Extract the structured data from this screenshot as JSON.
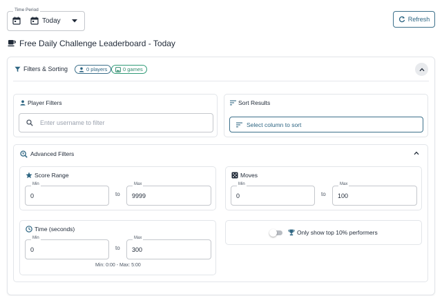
{
  "time_period": {
    "legend": "Time Period",
    "value": "Today"
  },
  "header": {
    "refresh_label": "Refresh",
    "page_title": "Free Daily Challenge Leaderboard - Today"
  },
  "filters": {
    "title": "Filters & Sorting",
    "players_chip": "0 players",
    "games_chip": "0 games"
  },
  "player_filters": {
    "title": "Player Filters",
    "search_placeholder": "Enter username to filter",
    "search_value": ""
  },
  "sort_results": {
    "title": "Sort Results",
    "button_label": "Select column to sort"
  },
  "advanced": {
    "title": "Advanced Filters",
    "to_label": "to",
    "score": {
      "title": "Score Range",
      "min_label": "Min",
      "min_value": "0",
      "max_label": "Max",
      "max_value": "9999"
    },
    "moves": {
      "title": "Moves",
      "min_label": "Min",
      "min_value": "0",
      "max_label": "Max",
      "max_value": "100"
    },
    "time": {
      "title": "Time (seconds)",
      "min_label": "Min",
      "min_value": "0",
      "max_label": "Max",
      "max_value": "300",
      "hint": "Min: 0:00 - Max: 5:00"
    },
    "top_performers": {
      "label": "Only show top 10% performers",
      "enabled": false
    }
  },
  "colors": {
    "accent": "#2d6582",
    "success": "#2f8a6c",
    "border": "#c4c7cc"
  },
  "icons": [
    "calendar-icon",
    "chevron-down-icon",
    "refresh-icon",
    "coffee-icon",
    "filter-icon",
    "person-icon",
    "image-icon",
    "chevron-up-icon",
    "search-icon",
    "sort-icon",
    "search-filter-icon",
    "star-icon",
    "dice-icon",
    "clock-icon",
    "trophy-icon"
  ]
}
